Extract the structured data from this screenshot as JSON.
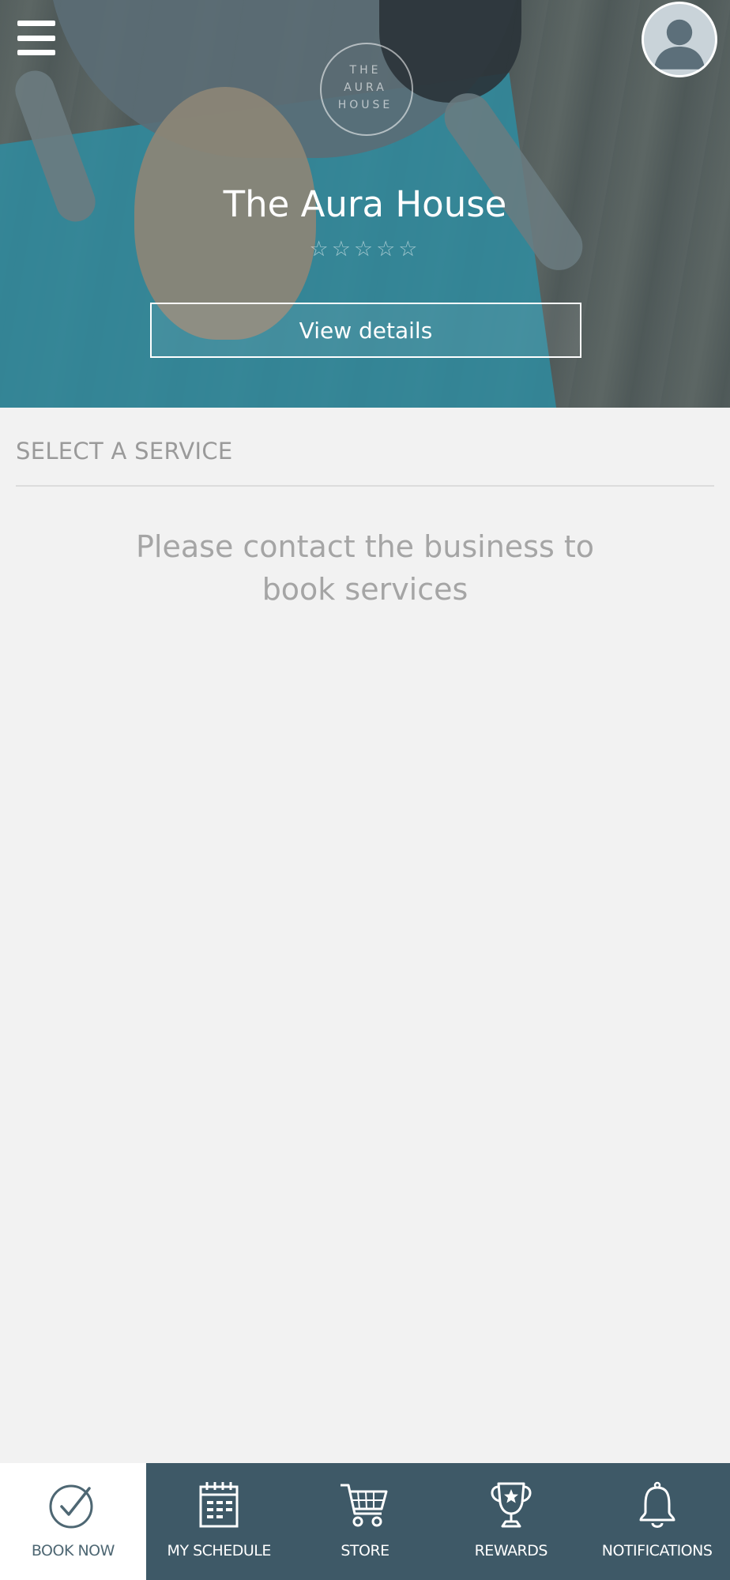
{
  "header": {
    "menu_icon": "hamburger-menu-icon",
    "avatar_icon": "user-avatar-icon",
    "logo_lines": [
      "THE",
      "AURA",
      "HOUSE"
    ],
    "business_name": "The Aura House",
    "rating_stars": "☆☆☆☆☆",
    "rating_value": 0,
    "view_details_label": "View details"
  },
  "main": {
    "section_title": "SELECT A SERVICE",
    "message": "Please contact the business to book services"
  },
  "bottom_nav": {
    "items": [
      {
        "label": "BOOK NOW",
        "icon": "check-circle-icon",
        "active": true
      },
      {
        "label": "MY SCHEDULE",
        "icon": "calendar-icon",
        "active": false
      },
      {
        "label": "STORE",
        "icon": "shopping-cart-icon",
        "active": false
      },
      {
        "label": "REWARDS",
        "icon": "trophy-icon",
        "active": false
      },
      {
        "label": "NOTIFICATIONS",
        "icon": "bell-icon",
        "active": false
      }
    ]
  },
  "colors": {
    "nav_background": "#3e5967",
    "page_background": "#f2f2f2",
    "muted_text": "#9a9a9a"
  }
}
